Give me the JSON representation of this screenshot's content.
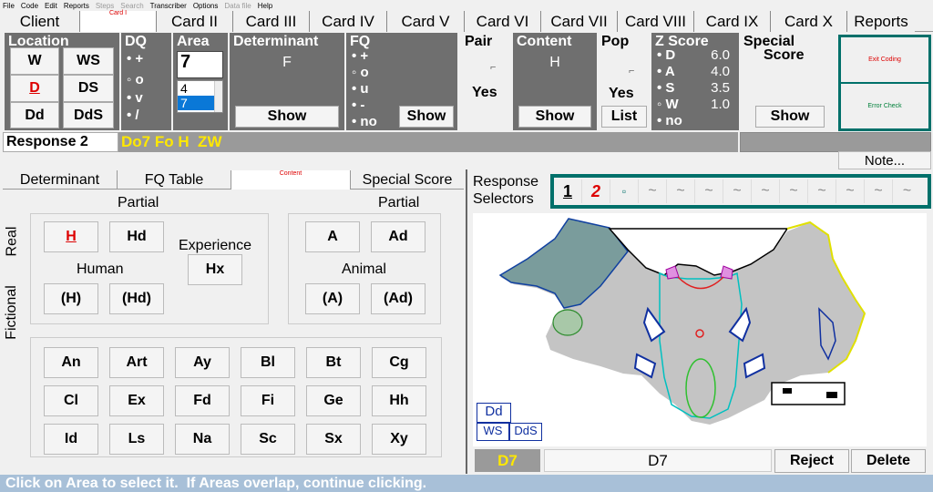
{
  "menu": [
    "File",
    "Code",
    "Edit",
    "Reports",
    "Steps",
    "Search",
    "Transcriber",
    "Options",
    "Data file",
    "Help"
  ],
  "menu_disabled": [
    false,
    false,
    false,
    false,
    true,
    true,
    false,
    false,
    true,
    false
  ],
  "tabs": {
    "client": "Client",
    "card1": "Card I",
    "card2": "Card II",
    "card3": "Card III",
    "card4": "Card IV",
    "card5": "Card V",
    "card6": "Card VI",
    "card7": "Card VII",
    "card8": "Card VIII",
    "card9": "Card IX",
    "card10": "Card X",
    "reports": "Reports"
  },
  "location": {
    "title": "Location",
    "w": "W",
    "ws": "WS",
    "d": "D",
    "ds": "DS",
    "dd": "Dd",
    "dds": "DdS"
  },
  "dq": {
    "title": "DQ",
    "opts": [
      "+",
      "o",
      "v",
      "/"
    ]
  },
  "area": {
    "title": "Area",
    "value": "7",
    "list": [
      "4",
      "7"
    ]
  },
  "determinant": {
    "title": "Determinant",
    "value": "F",
    "show": "Show"
  },
  "fq": {
    "title": "FQ",
    "opts": [
      "+",
      "o",
      "u",
      "-",
      "no"
    ],
    "show": "Show"
  },
  "pair": {
    "title": "Pair",
    "check": "⌐",
    "yes": "Yes"
  },
  "content": {
    "title": "Content",
    "value": "H",
    "show": "Show"
  },
  "pop": {
    "title": "Pop",
    "check": "⌐",
    "yes": "Yes",
    "list": "List"
  },
  "zscore": {
    "title": "Z Score",
    "rows": [
      {
        "l": "D",
        "v": "6.0"
      },
      {
        "l": "A",
        "v": "4.0"
      },
      {
        "l": "S",
        "v": "3.5"
      },
      {
        "l": "W",
        "v": "1.0"
      },
      {
        "l": "no",
        "v": ""
      }
    ]
  },
  "special": {
    "title1": "Special",
    "title2": "Score",
    "show": "Show"
  },
  "side": {
    "exit": "Exit Coding",
    "error": "Error Check"
  },
  "response": {
    "label": "Response 2",
    "code": "Do7 Fo H  ZW"
  },
  "note": "Note...",
  "subtabs": {
    "determinant": "Determinant",
    "fq": "FQ Table",
    "content": "Content",
    "special": "Special Score"
  },
  "content_panel": {
    "partial_left": "Partial",
    "partial_right": "Partial",
    "real": "Real",
    "fictional": "Fictional",
    "human": "Human",
    "animal": "Animal",
    "experience": "Experience",
    "h": "H",
    "hd": "Hd",
    "ph": "(H)",
    "phd": "(Hd)",
    "hx": "Hx",
    "a": "A",
    "ad": "Ad",
    "pa": "(A)",
    "pad": "(Ad)",
    "grid": [
      "An",
      "Art",
      "Ay",
      "Bl",
      "Bt",
      "Cg",
      "Cl",
      "Ex",
      "Fd",
      "Fi",
      "Ge",
      "Hh",
      "Id",
      "Ls",
      "Na",
      "Sc",
      "Sx",
      "Xy"
    ]
  },
  "selectors": {
    "label1": "Response",
    "label2": "Selectors",
    "items": [
      "1",
      "2",
      "▫",
      "~",
      "~",
      "~",
      "~",
      "~",
      "~",
      "~",
      "~",
      "~",
      "~"
    ]
  },
  "blot": {
    "dd": "Dd",
    "ws": "WS",
    "dds": "DdS"
  },
  "bottom": {
    "area": "D7",
    "area_name": "D7",
    "reject": "Reject",
    "delete": "Delete"
  },
  "status": "Click on Area to select it.  If Areas overlap, continue clicking."
}
